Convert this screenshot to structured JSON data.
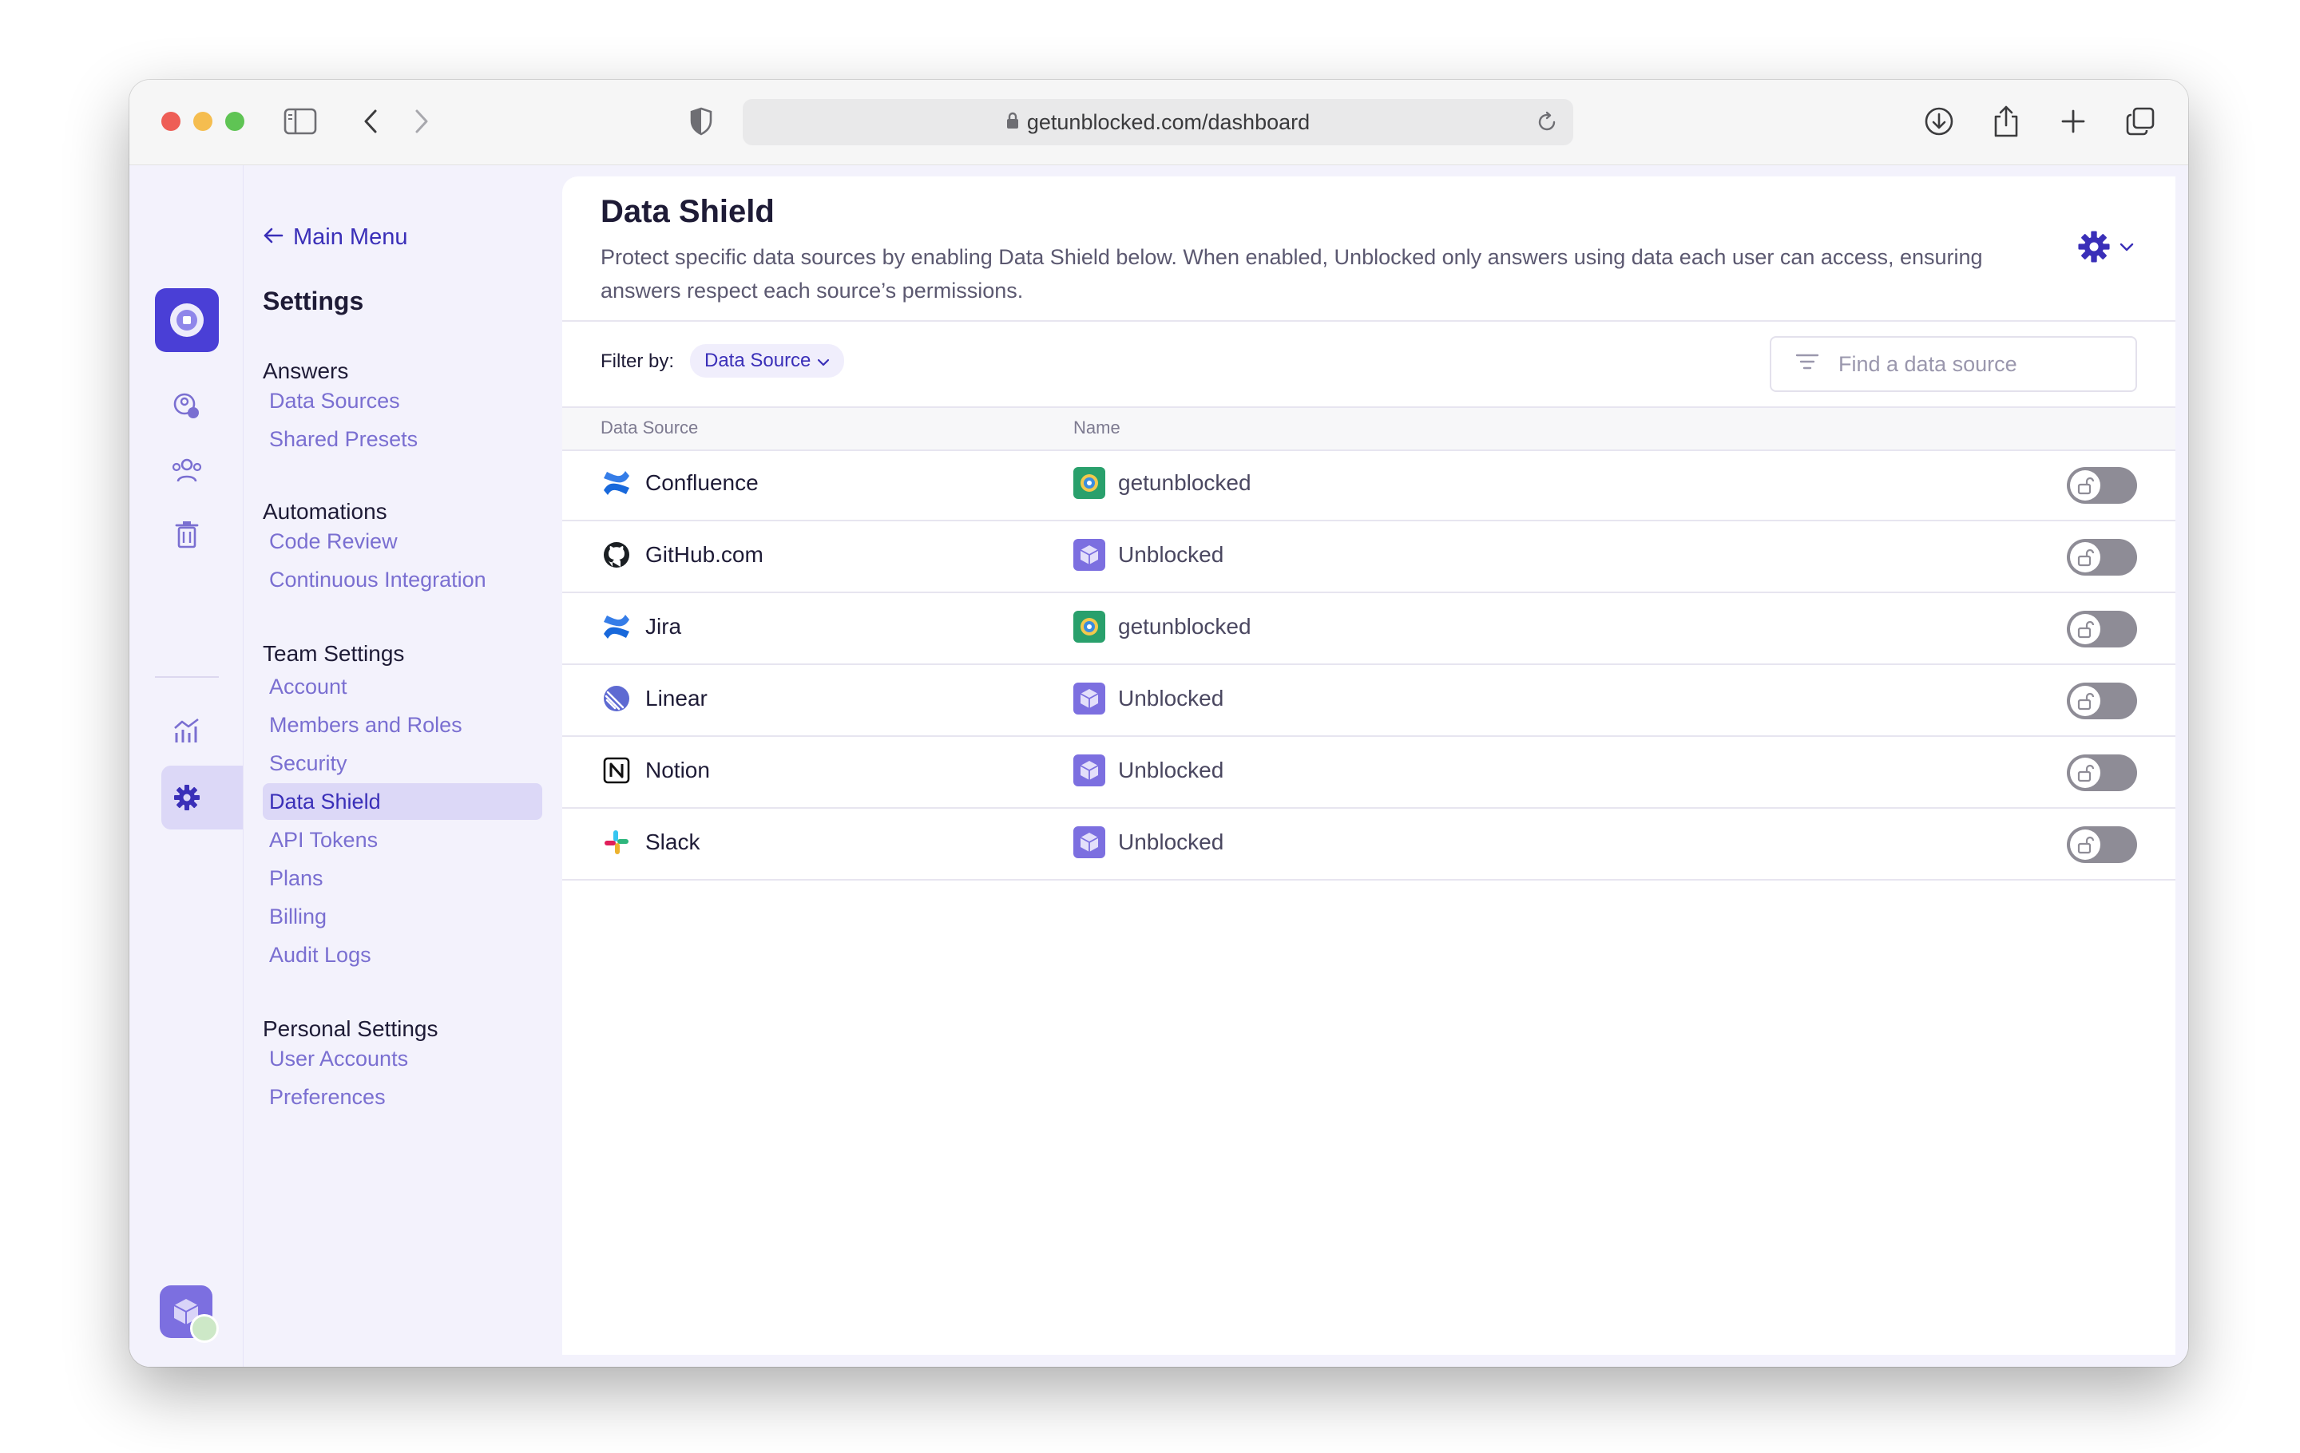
{
  "browser": {
    "url": "getunblocked.com/dashboard"
  },
  "sidenav": {
    "back_label": "Main Menu",
    "title": "Settings",
    "groups": [
      {
        "label": "Answers",
        "items": [
          "Data Sources",
          "Shared Presets"
        ]
      },
      {
        "label": "Automations",
        "items": [
          "Code Review",
          "Continuous Integration"
        ]
      },
      {
        "label": "Team Settings",
        "items": [
          "Account",
          "Members and Roles",
          "Security",
          "Data Shield",
          "API Tokens",
          "Plans",
          "Billing",
          "Audit Logs"
        ]
      },
      {
        "label": "Personal Settings",
        "items": [
          "User Accounts",
          "Preferences"
        ]
      }
    ],
    "active_item": "Data Shield"
  },
  "page": {
    "title": "Data Shield",
    "description": "Protect specific data sources by enabling Data Shield below. When enabled, Unblocked only answers using data each user can access, ensuring answers respect each source’s permissions."
  },
  "filter": {
    "label": "Filter by:",
    "chip": "Data Source",
    "search_placeholder": "Find a data source"
  },
  "table": {
    "columns": [
      "Data Source",
      "Name"
    ],
    "rows": [
      {
        "source": "Confluence",
        "source_icon": "confluence-icon",
        "name": "getunblocked",
        "name_icon": "team-avatar-icon",
        "enabled": false
      },
      {
        "source": "GitHub.com",
        "source_icon": "github-icon",
        "name": "Unblocked",
        "name_icon": "org-avatar-icon",
        "enabled": false
      },
      {
        "source": "Jira",
        "source_icon": "jira-icon",
        "name": "getunblocked",
        "name_icon": "team-avatar-icon",
        "enabled": false
      },
      {
        "source": "Linear",
        "source_icon": "linear-icon",
        "name": "Unblocked",
        "name_icon": "org-avatar-icon",
        "enabled": false
      },
      {
        "source": "Notion",
        "source_icon": "notion-icon",
        "name": "Unblocked",
        "name_icon": "org-avatar-icon",
        "enabled": false
      },
      {
        "source": "Slack",
        "source_icon": "slack-icon",
        "name": "Unblocked",
        "name_icon": "org-avatar-icon",
        "enabled": false
      }
    ]
  },
  "colors": {
    "accent": "#3a2fb8",
    "nav_text": "#7a6fd1",
    "nav_bg": "#f3f2fc",
    "active_bg": "#dcd8f7",
    "toggle_off": "#8e8c96"
  }
}
